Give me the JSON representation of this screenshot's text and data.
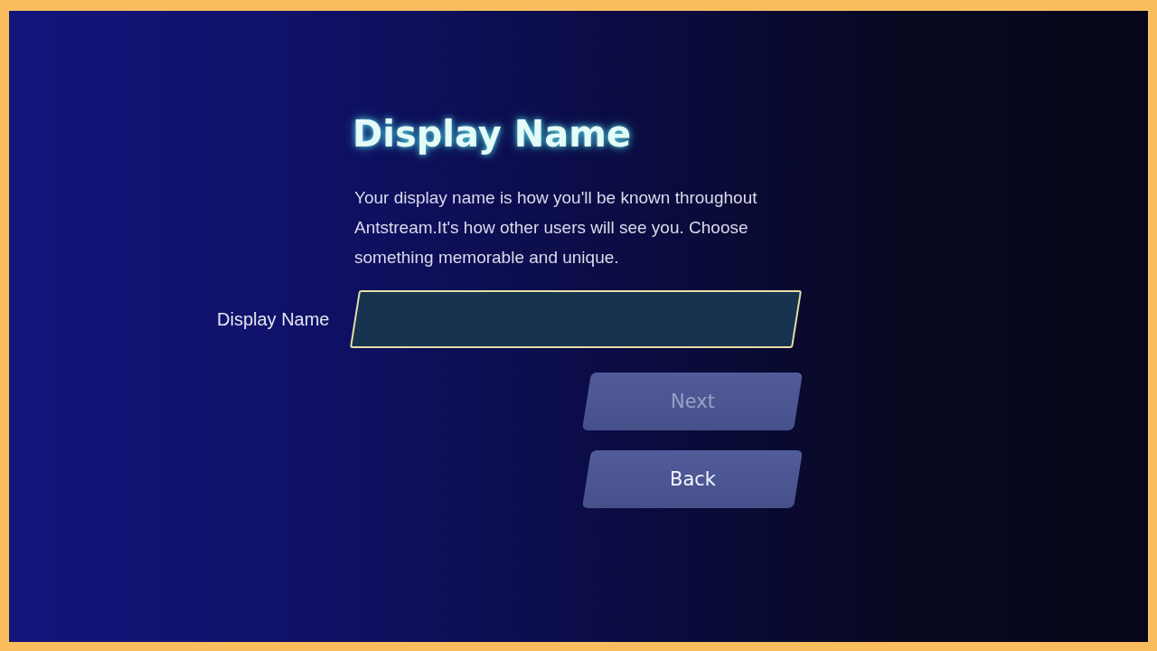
{
  "title": "Display Name",
  "description": "Your display name is how you'll be known throughout Antstream.It's how other users will see you. Choose something memorable and unique.",
  "display_name_field": {
    "label": "Display Name",
    "focused": true
  },
  "buttons": [
    {
      "label": "Next",
      "disabled": true
    },
    {
      "label": "Back",
      "disabled": false
    }
  ]
}
